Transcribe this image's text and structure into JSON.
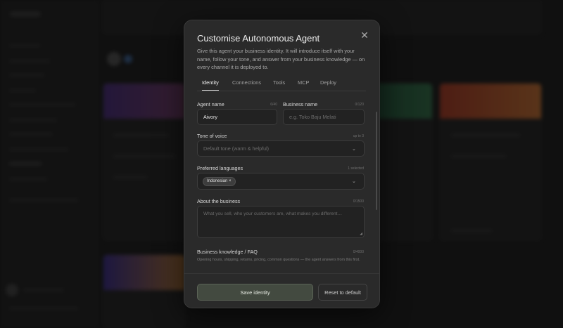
{
  "modal": {
    "title": "Customise Autonomous Agent",
    "description": "Give this agent your business identity. It will introduce itself with your name, follow your tone, and answer from your business knowledge — on every channel it is deployed to.",
    "close_icon": "close-icon"
  },
  "tabs": [
    {
      "label": "Identity",
      "active": true
    },
    {
      "label": "Connections",
      "active": false
    },
    {
      "label": "Tools",
      "active": false
    },
    {
      "label": "MCP",
      "active": false
    },
    {
      "label": "Deploy",
      "active": false
    }
  ],
  "form": {
    "agent_name": {
      "label": "Agent name",
      "counter": "6/40",
      "value": "Aivory"
    },
    "business_name": {
      "label": "Business name",
      "counter": "0/120",
      "placeholder": "e.g. Toko Baju Melati"
    },
    "tone": {
      "label": "Tone of voice",
      "hint": "up to 3",
      "placeholder": "Default tone (warm & helpful)"
    },
    "languages": {
      "label": "Preferred languages",
      "hint": "1 selected",
      "chip": "Indonesian ×"
    },
    "about": {
      "label": "About the business",
      "counter": "0/1500",
      "placeholder": "What you sell, who your customers are, what makes you different…"
    },
    "knowledge": {
      "label": "Business knowledge / FAQ",
      "counter": "0/4000",
      "subtext": "Opening hours, shipping, returns, pricing, common questions — the agent answers from this first."
    }
  },
  "footer": {
    "save_label": "Save identity",
    "reset_label": "Reset to default"
  },
  "colors": {
    "modal_bg": "#2a2a2a",
    "primary_button": "#434a40",
    "backdrop": "#141414"
  }
}
